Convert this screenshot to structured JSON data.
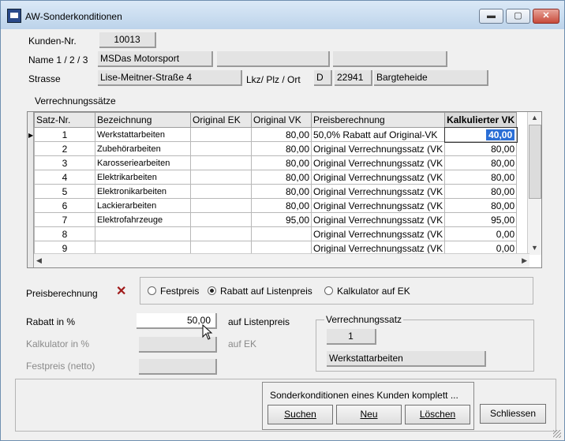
{
  "window": {
    "title": "AW-Sonderkonditionen"
  },
  "titlebar_buttons": {
    "minimize": "▬",
    "maximize": "▢",
    "close": "✕"
  },
  "customer": {
    "kunden_nr_label": "Kunden-Nr.",
    "kunden_nr": "10013",
    "name_label": "Name 1 / 2 / 3",
    "name1": "MSDas Motorsport",
    "name2": "",
    "name3": "",
    "strasse_label": "Strasse",
    "strasse": "Lise-Meitner-Straße 4",
    "lkz_label": "Lkz/ Plz / Ort",
    "lkz": "D",
    "plz": "22941",
    "ort": "Bargteheide"
  },
  "grid": {
    "section_label": "Verrechnungssätze",
    "columns": [
      "Satz-Nr.",
      "Bezeichnung",
      "Original EK",
      "Original VK",
      "Preisberechnung",
      "Kalkulierter VK"
    ],
    "rows": [
      {
        "nr": "1",
        "bez": "Werkstattarbeiten",
        "ek": "",
        "vk": "80,00",
        "preis": "50,0% Rabatt auf Original-VK",
        "kalk": "40,00"
      },
      {
        "nr": "2",
        "bez": "Zubehörarbeiten",
        "ek": "",
        "vk": "80,00",
        "preis": "Original Verrechnungssatz (VK",
        "kalk": "80,00"
      },
      {
        "nr": "3",
        "bez": "Karosseriearbeiten",
        "ek": "",
        "vk": "80,00",
        "preis": "Original Verrechnungssatz (VK",
        "kalk": "80,00"
      },
      {
        "nr": "4",
        "bez": "Elektrikarbeiten",
        "ek": "",
        "vk": "80,00",
        "preis": "Original Verrechnungssatz (VK",
        "kalk": "80,00"
      },
      {
        "nr": "5",
        "bez": "Elektronikarbeiten",
        "ek": "",
        "vk": "80,00",
        "preis": "Original Verrechnungssatz (VK",
        "kalk": "80,00"
      },
      {
        "nr": "6",
        "bez": "Lackierarbeiten",
        "ek": "",
        "vk": "80,00",
        "preis": "Original Verrechnungssatz (VK",
        "kalk": "80,00"
      },
      {
        "nr": "7",
        "bez": "Elektrofahrzeuge",
        "ek": "",
        "vk": "95,00",
        "preis": "Original Verrechnungssatz (VK",
        "kalk": "95,00"
      },
      {
        "nr": "8",
        "bez": "",
        "ek": "",
        "vk": "",
        "preis": "Original Verrechnungssatz (VK",
        "kalk": "0,00"
      },
      {
        "nr": "9",
        "bez": "",
        "ek": "",
        "vk": "",
        "preis": "Original Verrechnungssatz (VK",
        "kalk": "0,00"
      }
    ]
  },
  "pricing": {
    "label": "Preisberechnung",
    "clear_icon": "✕",
    "options": [
      "Festpreis",
      "Rabatt auf Listenpreis",
      "Kalkulator auf EK"
    ],
    "selected": "Rabatt auf Listenpreis",
    "rabatt_label": "Rabatt in %",
    "rabatt_value": "50,00",
    "rabatt_suffix": "auf Listenpreis",
    "kalkulator_label": "Kalkulator in %",
    "kalkulator_value": "",
    "kalkulator_suffix": "auf EK",
    "festpreis_label": "Festpreis (netto)",
    "festpreis_value": ""
  },
  "verrechnungssatz": {
    "legend": "Verrechnungssatz",
    "nr": "1",
    "bezeichnung": "Werkstattarbeiten"
  },
  "actions": {
    "group_caption": "Sonderkonditionen eines Kunden komplett ...",
    "suchen": "Suchen",
    "neu": "Neu",
    "loeschen": "Löschen",
    "schliessen": "Schliessen"
  }
}
